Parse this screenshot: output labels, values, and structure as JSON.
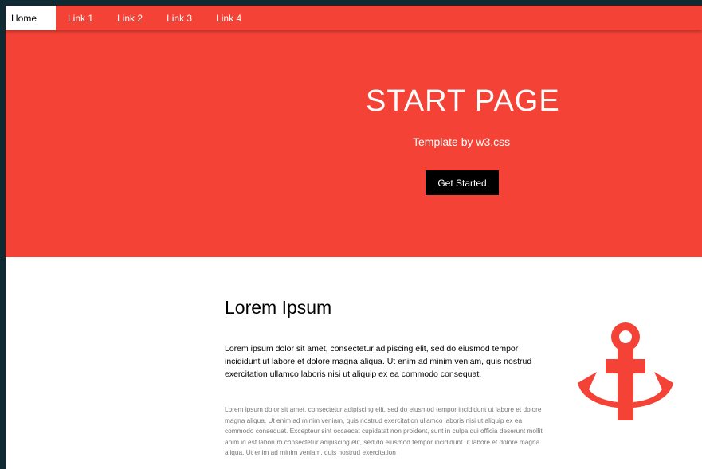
{
  "nav": {
    "items": [
      {
        "label": "Home",
        "active": true
      },
      {
        "label": "Link 1",
        "active": false
      },
      {
        "label": "Link 2",
        "active": false
      },
      {
        "label": "Link 3",
        "active": false
      },
      {
        "label": "Link 4",
        "active": false
      }
    ]
  },
  "hero": {
    "title": "START PAGE",
    "subtitle": "Template by w3.css",
    "button_label": "Get Started"
  },
  "section": {
    "title": "Lorem Ipsum",
    "lead": "Lorem ipsum dolor sit amet, consectetur adipiscing elit, sed do eiusmod tempor incididunt ut labore et dolore magna aliqua. Ut enim ad minim veniam, quis nostrud exercitation ullamco laboris nisi ut aliquip ex ea commodo consequat.",
    "body": "Lorem ipsum dolor sit amet, consectetur adipiscing elit, sed do eiusmod tempor incididunt ut labore et dolore magna aliqua. Ut enim ad minim veniam, quis nostrud exercitation ullamco laboris nisi ut aliquip ex ea commodo consequat. Excepteur sint occaecat cupidatat non proident, sunt in culpa qui officia deserunt mollit anim id est laborum consectetur adipiscing elit, sed do eiusmod tempor incididunt ut labore et dolore magna aliqua. Ut enim ad minim veniam, quis nostrud exercitation",
    "icon": "anchor-icon"
  },
  "colors": {
    "accent": "#f44336",
    "button": "#000000",
    "frame": "#0f2a33"
  }
}
